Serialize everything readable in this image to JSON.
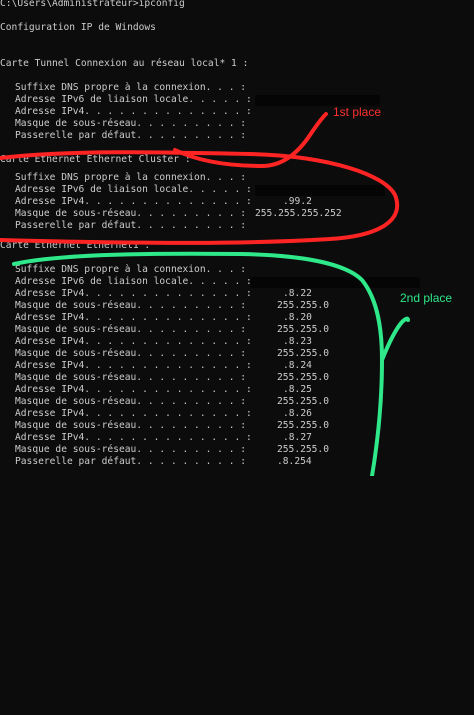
{
  "prompt": "C:\\Users\\Administrateur>ipconfig",
  "header": "Configuration IP de Windows",
  "adapters": [
    {
      "title": "Carte Tunnel Connexion au réseau local* 1 :",
      "lines": [
        {
          "label": "Suffixe DNS propre à la connexion. . . :",
          "value": ""
        },
        {
          "label": "Adresse IPv6 de liaison locale. . . . . :",
          "value": ""
        },
        {
          "label": "Adresse IPv4. . . . . . . . . . . . . . :",
          "value": ""
        },
        {
          "label": "Masque de sous-réseau. . . . . . . . . :",
          "value": ""
        },
        {
          "label": "Passerelle par défaut. . . . . . . . . :",
          "value": ""
        }
      ]
    },
    {
      "title": "Carte Ethernet Ethernet Cluster :",
      "lines": [
        {
          "label": "Suffixe DNS propre à la connexion. . . :",
          "value": ""
        },
        {
          "label": "Adresse IPv6 de liaison locale. . . . . :",
          "value": ""
        },
        {
          "label": "Adresse IPv4. . . . . . . . . . . . . . :",
          "value": ".99.2"
        },
        {
          "label": "Masque de sous-réseau. . . . . . . . . :",
          "value": "255.255.255.252"
        },
        {
          "label": "Passerelle par défaut. . . . . . . . . :",
          "value": ""
        }
      ]
    },
    {
      "title": "Carte Ethernet Ethernet1 :",
      "lines": [
        {
          "label": "Suffixe DNS propre à la connexion. . . :",
          "value": ""
        },
        {
          "label": "Adresse IPv6 de liaison locale. . . . . :",
          "value": ""
        },
        {
          "label": "Adresse IPv4. . . . . . . . . . . . . . :",
          "value": ".8.22"
        },
        {
          "label": "Masque de sous-réseau. . . . . . . . . :",
          "value": "255.255.0"
        },
        {
          "label": "Adresse IPv4. . . . . . . . . . . . . . :",
          "value": ".8.20"
        },
        {
          "label": "Masque de sous-réseau. . . . . . . . . :",
          "value": "255.255.0"
        },
        {
          "label": "Adresse IPv4. . . . . . . . . . . . . . :",
          "value": ".8.23"
        },
        {
          "label": "Masque de sous-réseau. . . . . . . . . :",
          "value": "255.255.0"
        },
        {
          "label": "Adresse IPv4. . . . . . . . . . . . . . :",
          "value": ".8.24"
        },
        {
          "label": "Masque de sous-réseau. . . . . . . . . :",
          "value": "255.255.0"
        },
        {
          "label": "Adresse IPv4. . . . . . . . . . . . . . :",
          "value": ".8.25"
        },
        {
          "label": "Masque de sous-réseau. . . . . . . . . :",
          "value": "255.255.0"
        },
        {
          "label": "Adresse IPv4. . . . . . . . . . . . . . :",
          "value": ".8.26"
        },
        {
          "label": "Masque de sous-réseau. . . . . . . . . :",
          "value": "255.255.0"
        },
        {
          "label": "Adresse IPv4. . . . . . . . . . . . . . :",
          "value": ".8.27"
        },
        {
          "label": "Masque de sous-réseau. . . . . . . . . :",
          "value": "255.255.0"
        },
        {
          "label": "Passerelle par défaut. . . . . . . . . :",
          "value": ".8.254"
        }
      ]
    }
  ],
  "annotations": {
    "first": {
      "text": "1st place",
      "color": "#ff3030"
    },
    "second": {
      "text": "2nd place",
      "color": "#2ee88a"
    }
  },
  "colors": {
    "background": "#0c0c0c",
    "text": "#cccccc"
  }
}
